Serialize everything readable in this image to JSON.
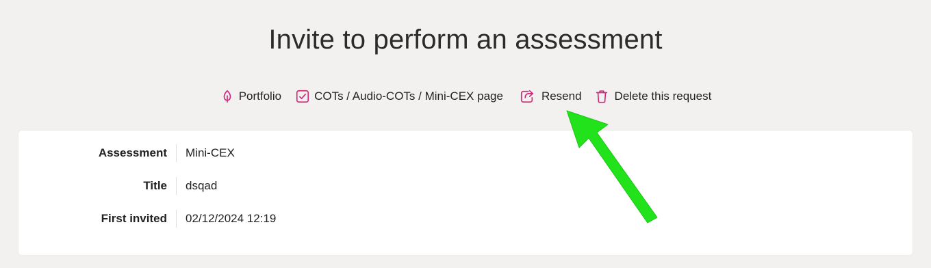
{
  "page": {
    "title": "Invite to perform an assessment"
  },
  "actions": {
    "portfolio": {
      "label": "Portfolio",
      "icon": "leaf-icon"
    },
    "cots": {
      "label": "COTs / Audio-COTs / Mini-CEX page",
      "icon": "checkbox-icon"
    },
    "resend": {
      "label": "Resend",
      "icon": "share-arrow-icon"
    },
    "delete": {
      "label": "Delete this request",
      "icon": "trash-icon"
    }
  },
  "details": {
    "rows": [
      {
        "label": "Assessment",
        "value": "Mini-CEX"
      },
      {
        "label": "Title",
        "value": "dsqad"
      },
      {
        "label": "First invited",
        "value": "02/12/2024 12:19"
      }
    ]
  },
  "colors": {
    "accent": "#d1277a",
    "annotation_arrow": "#22e21c",
    "background": "#f2f1ef",
    "card": "#ffffff"
  }
}
